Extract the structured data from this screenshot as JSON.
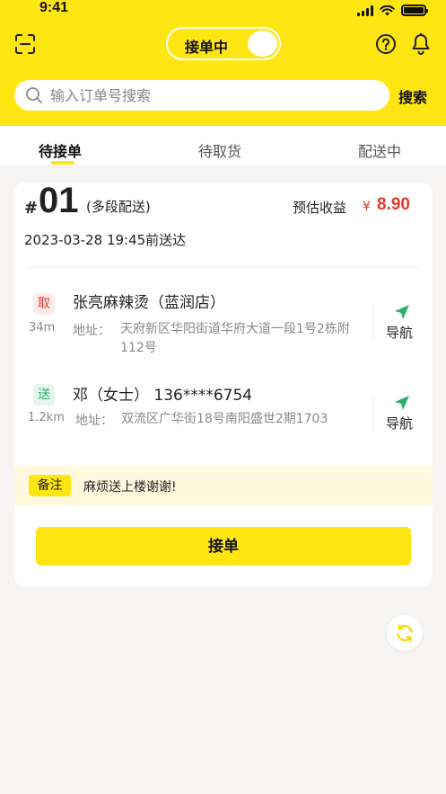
{
  "status_bar": {
    "time": "9:41"
  },
  "header": {
    "toggle_label": "接单中",
    "search_placeholder": "输入订单号搜索",
    "search_button": "搜索",
    "icons": [
      "scan-icon",
      "help-icon",
      "bell-icon",
      "search-icon"
    ]
  },
  "tabs": [
    {
      "label": "待接单",
      "active": true
    },
    {
      "label": "待取货",
      "active": false
    },
    {
      "label": "配送中",
      "active": false
    }
  ],
  "order": {
    "hash": "#",
    "number": "01",
    "type": "(多段配送)",
    "earnings_label": "预估收益",
    "currency": "¥",
    "earnings": "8.90",
    "deadline": "2023-03-28 19:45前送达",
    "pickup": {
      "badge": "取",
      "name": "张亮麻辣烫（蓝润店）",
      "distance": "34m",
      "address_label": "地址：",
      "address": "天府新区华阳街道华府大道一段1号2栋附112号",
      "nav_label": "导航"
    },
    "delivery": {
      "badge": "送",
      "name": "邓（女士） 136****6754",
      "distance": "1.2km",
      "address_label": "地址：",
      "address": "双流区广华街18号南阳盛世2期1703",
      "nav_label": "导航"
    },
    "remark_tag": "备注",
    "remark": "麻烦送上楼谢谢!",
    "accept_button": "接单"
  },
  "colors": {
    "brand_yellow": "#ffe511",
    "price_red": "#e23b2b",
    "nav_green": "#2bb06b"
  }
}
